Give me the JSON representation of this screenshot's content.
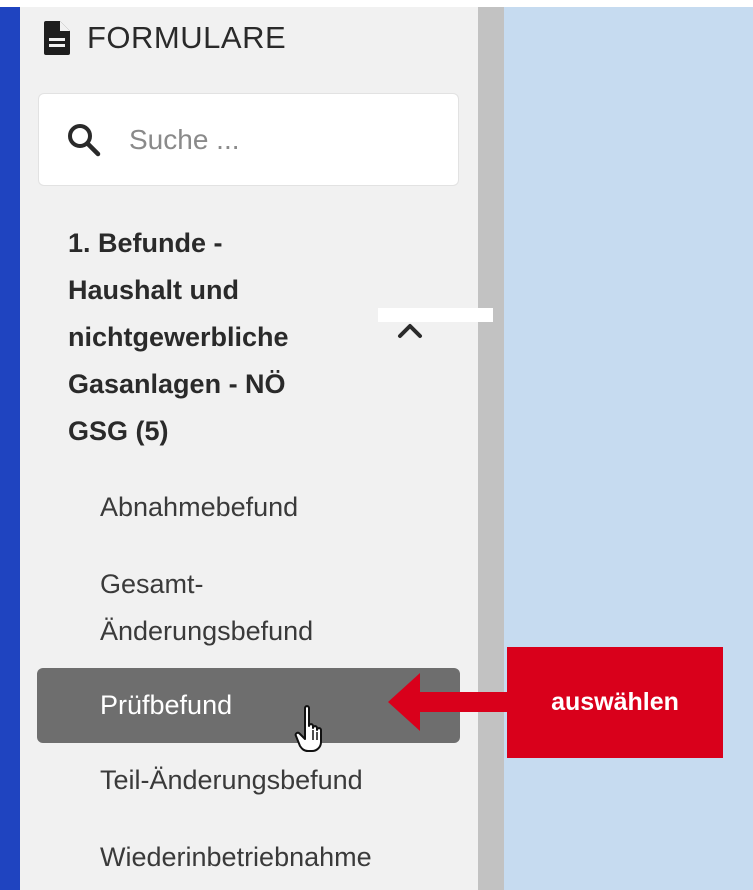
{
  "sidebar": {
    "header_title": "FORMULARE",
    "header_icon": "document-icon",
    "search_placeholder": "Suche ...",
    "group": {
      "title": "1. Befunde -\nHaushalt und\nnichtgewerbliche\nGasanlagen - NÖ\nGSG (5)",
      "expanded": true,
      "items": [
        {
          "label": "Abnahmebefund",
          "selected": false
        },
        {
          "label": "Gesamt-\nÄnderungsbefund",
          "selected": false
        },
        {
          "label": "Prüfbefund",
          "selected": true
        },
        {
          "label": "Teil-Änderungsbefund",
          "selected": false
        },
        {
          "label": "Wiederinbetriebnahme",
          "selected": false
        }
      ]
    }
  },
  "annotation": {
    "callout_label": "auswählen",
    "color": "#d9001b"
  },
  "colors": {
    "sidebar_bg": "#f1f1f1",
    "selected_bg": "#6e6e6e",
    "content_bg": "#c6dbf0",
    "accent_blue": "#1f44c0"
  }
}
